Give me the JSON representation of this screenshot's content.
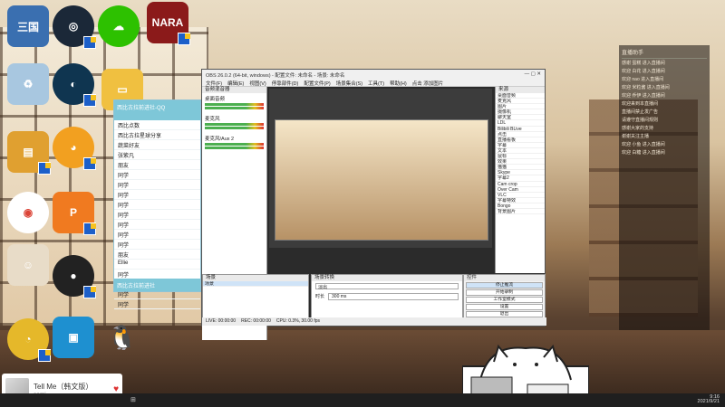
{
  "desktop_icons": [
    {
      "label": "三国",
      "name": "pc-icon"
    },
    {
      "label": "",
      "name": "steam-icon"
    },
    {
      "label": "",
      "name": "wechat-icon"
    },
    {
      "label": "NARA",
      "name": "game-icon"
    },
    {
      "label": "",
      "name": "recycle-bin-icon"
    },
    {
      "label": "",
      "name": "app-icon"
    },
    {
      "label": "",
      "name": "folder-icon"
    },
    {
      "label": "",
      "name": "chrome-icon"
    },
    {
      "label": "",
      "name": "pdf-icon"
    },
    {
      "label": "",
      "name": "obs-icon"
    },
    {
      "label": "",
      "name": "qq-icon"
    }
  ],
  "qq": {
    "header": "西比古拉前进社-QQ",
    "rows": [
      "西比点数",
      "西比古拉星球分享",
      "蔬菜好友",
      "张紫凡",
      "朋友",
      "同学",
      "同学",
      "同学",
      "同学",
      "同学",
      "同学",
      "同学",
      "同学",
      "朋友",
      "Ellie",
      "同学",
      "同学",
      "同学",
      "同学"
    ],
    "footer": "西比古拉前进社"
  },
  "obs": {
    "title": "OBS 26.0.2 (64-bit, windows) - 配置文件: 未命名 - 场景: 未命名",
    "menu": [
      "文件(F)",
      "编辑(E)",
      "视图(V)",
      "停靠部件(D)",
      "配置文件(P)",
      "场景集合(S)",
      "工具(T)",
      "帮助(H)",
      "点击 添加图片"
    ],
    "mixer_title": "音频混音器",
    "mixer": [
      "桌面音频",
      "麦克风",
      "麦克风/Aux 2"
    ],
    "sources_title": "来源",
    "sources": [
      "桌面音频",
      "麦克风",
      "图片",
      "摄像机",
      "聊天室",
      "LDL",
      "Bilibili BLive",
      "点击",
      "直播看板",
      "字幕",
      "文本",
      "鼠标",
      "效果",
      "猫猫",
      "Skype",
      "字幕2",
      "Cam crop",
      "Over Cam",
      "VLC",
      "字幕特效",
      "Bongo",
      "背景图片"
    ],
    "scenes_title": "场景",
    "scenes": [
      "场景"
    ],
    "transitions_title": "场景转换",
    "transition_value": "淡出",
    "duration_label": "时长",
    "duration_value": "300 ms",
    "controls_title": "控件",
    "controls": [
      "停止推流",
      "开始录制",
      "工作室模式",
      "设置",
      "退出"
    ],
    "status": [
      "LIVE: 00:00:00",
      "REC: 00:00:00",
      "CPU: 0.3%, 30.00 fps"
    ]
  },
  "chat": {
    "title": "直播助手",
    "lines": [
      "感谢 蛋糕 进入直播间",
      "欢迎 白花 进入直播间",
      "欢迎 nao 进入直播间",
      "欢迎 米粒酱 进入直播间",
      "欢迎 乔伊 进入直播间",
      "欢迎来到本直播间",
      "直播间禁止发广告",
      "请遵守直播间规则",
      "感谢大家的支持",
      "谢谢关注主播",
      "欢迎 小鱼 进入直播间",
      "欢迎 白糖 进入直播间"
    ]
  },
  "music": {
    "title": "Tell Me（韩文版）",
    "artist": "sami"
  },
  "taskbar": {
    "time": "9:16",
    "date": "2021/9/21"
  },
  "colors": {
    "obs_bg": "#2b2b2b",
    "qq_accent": "#7ec7d8"
  }
}
